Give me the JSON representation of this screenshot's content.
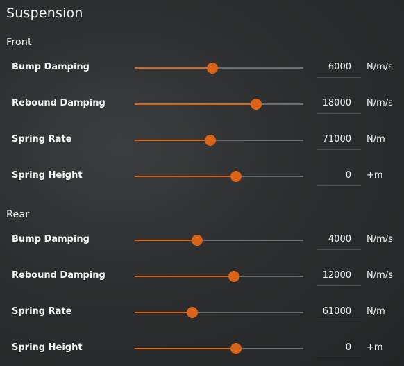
{
  "title": "Suspension",
  "colors": {
    "accent": "#db6418",
    "track": "#6b6d6e"
  },
  "sections": [
    {
      "label": "Front",
      "rows": [
        {
          "label": "Bump Damping",
          "value": "6000",
          "unit": "N/m/s",
          "level": 0.46
        },
        {
          "label": "Rebound Damping",
          "value": "18000",
          "unit": "N/m/s",
          "level": 0.72
        },
        {
          "label": "Spring Rate",
          "value": "71000",
          "unit": "N/m",
          "level": 0.45
        },
        {
          "label": "Spring Height",
          "value": "0",
          "unit": "+m",
          "level": 0.6
        }
      ]
    },
    {
      "label": "Rear",
      "rows": [
        {
          "label": "Bump Damping",
          "value": "4000",
          "unit": "N/m/s",
          "level": 0.37
        },
        {
          "label": "Rebound Damping",
          "value": "12000",
          "unit": "N/m/s",
          "level": 0.59
        },
        {
          "label": "Spring Rate",
          "value": "61000",
          "unit": "N/m",
          "level": 0.34
        },
        {
          "label": "Spring Height",
          "value": "0",
          "unit": "+m",
          "level": 0.6
        }
      ]
    }
  ]
}
